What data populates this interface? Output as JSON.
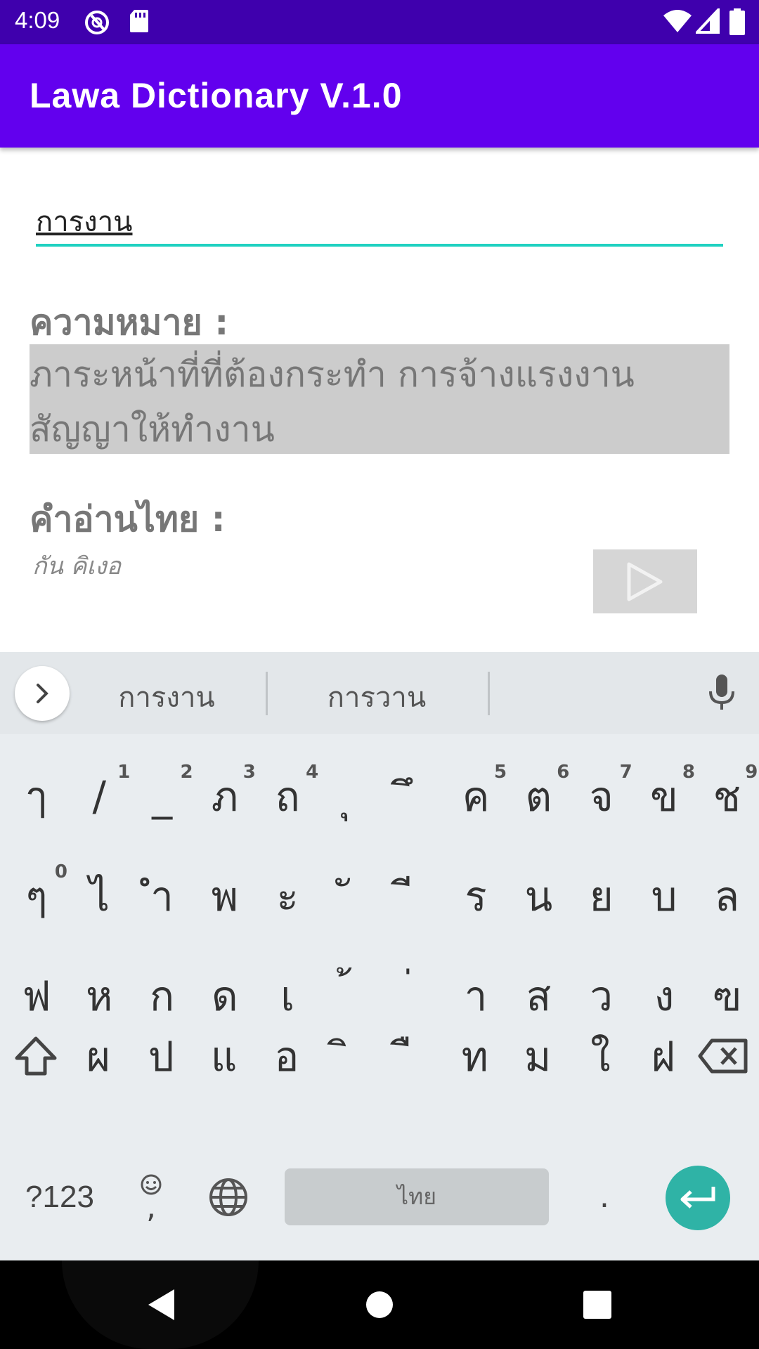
{
  "status_bar": {
    "time": "4:09",
    "icons": [
      "sync-disabled-icon",
      "sd-card-icon",
      "wifi-icon",
      "cell-signal-icon",
      "battery-icon"
    ]
  },
  "app_bar": {
    "title": "Lawa Dictionary V.1.0",
    "color": "#6200ee"
  },
  "search": {
    "value": "การงาน",
    "underline_color": "#1fd1c1"
  },
  "meaning": {
    "label": "ความหมาย :",
    "line1": "ภาระหน้าที่ที่ต้องกระทำ  การจ้างแรงงาน",
    "line2": "สัญญาให้ทำงาน"
  },
  "thai_reading": {
    "label": "คำอ่านไทย :",
    "value": "กัน คิเงอ",
    "play_icon": "play-icon"
  },
  "keyboard": {
    "suggestions": [
      "การงาน",
      "การวาน"
    ],
    "row1": [
      {
        "char": "ๅ",
        "hint": ""
      },
      {
        "char": "/",
        "hint": "1"
      },
      {
        "char": "_",
        "hint": "2"
      },
      {
        "char": "ภ",
        "hint": "3"
      },
      {
        "char": "ถ",
        "hint": "4"
      },
      {
        "char": "ุ",
        "hint": ""
      },
      {
        "char": "ึ",
        "hint": ""
      },
      {
        "char": "ค",
        "hint": "5"
      },
      {
        "char": "ต",
        "hint": "6"
      },
      {
        "char": "จ",
        "hint": "7"
      },
      {
        "char": "ข",
        "hint": "8"
      },
      {
        "char": "ช",
        "hint": "9"
      }
    ],
    "row2": [
      {
        "char": "ๆ",
        "hint": "0"
      },
      {
        "char": "ไ",
        "hint": ""
      },
      {
        "char": "ำ",
        "hint": ""
      },
      {
        "char": "พ",
        "hint": ""
      },
      {
        "char": "ะ",
        "hint": ""
      },
      {
        "char": "ั",
        "hint": ""
      },
      {
        "char": "ี",
        "hint": ""
      },
      {
        "char": "ร",
        "hint": ""
      },
      {
        "char": "น",
        "hint": ""
      },
      {
        "char": "ย",
        "hint": ""
      },
      {
        "char": "บ",
        "hint": ""
      },
      {
        "char": "ล",
        "hint": ""
      }
    ],
    "row3": [
      {
        "char": "ฟ",
        "hint": ""
      },
      {
        "char": "ห",
        "hint": ""
      },
      {
        "char": "ก",
        "hint": ""
      },
      {
        "char": "ด",
        "hint": ""
      },
      {
        "char": "เ",
        "hint": ""
      },
      {
        "char": "้",
        "hint": ""
      },
      {
        "char": "่",
        "hint": ""
      },
      {
        "char": "า",
        "hint": ""
      },
      {
        "char": "ส",
        "hint": ""
      },
      {
        "char": "ว",
        "hint": ""
      },
      {
        "char": "ง",
        "hint": ""
      },
      {
        "char": "ฃ",
        "hint": ""
      }
    ],
    "row4": [
      {
        "char": "ผ",
        "hint": ""
      },
      {
        "char": "ป",
        "hint": ""
      },
      {
        "char": "แ",
        "hint": ""
      },
      {
        "char": "อ",
        "hint": ""
      },
      {
        "char": "ิ",
        "hint": ""
      },
      {
        "char": "ื",
        "hint": ""
      },
      {
        "char": "ท",
        "hint": ""
      },
      {
        "char": "ม",
        "hint": ""
      },
      {
        "char": "ใ",
        "hint": ""
      },
      {
        "char": "ฝ",
        "hint": ""
      }
    ],
    "symbols_label": "?123",
    "emoji_comma": ",",
    "space_label": "ไทย",
    "period": ".",
    "accent": "#2fb3a6"
  },
  "nav_bar": {
    "icons": [
      "back-icon",
      "home-icon",
      "recents-icon"
    ]
  }
}
